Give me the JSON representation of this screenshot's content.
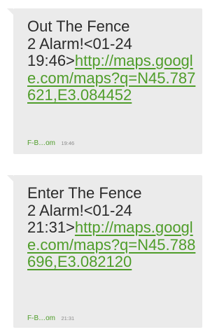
{
  "messages": [
    {
      "body_text": "Out The Fence\n2 Alarm!<01-24\n19:46>",
      "link_text": "http://maps.google.com/maps?q=N45.787621,E3.084452",
      "sender": "F-B…om",
      "time": "19:46"
    },
    {
      "body_text": "Enter The Fence\n2 Alarm!<01-24\n21:31>",
      "link_text": "http://maps.google.com/maps?q=N45.788696,E3.082120",
      "sender": "F-B…om",
      "time": "21:31"
    }
  ],
  "colors": {
    "bubble_bg": "#ebebeb",
    "text": "#2b2b2b",
    "link": "#4f9d2a",
    "sender": "#4f9d2a",
    "time": "#8a8a8a"
  }
}
